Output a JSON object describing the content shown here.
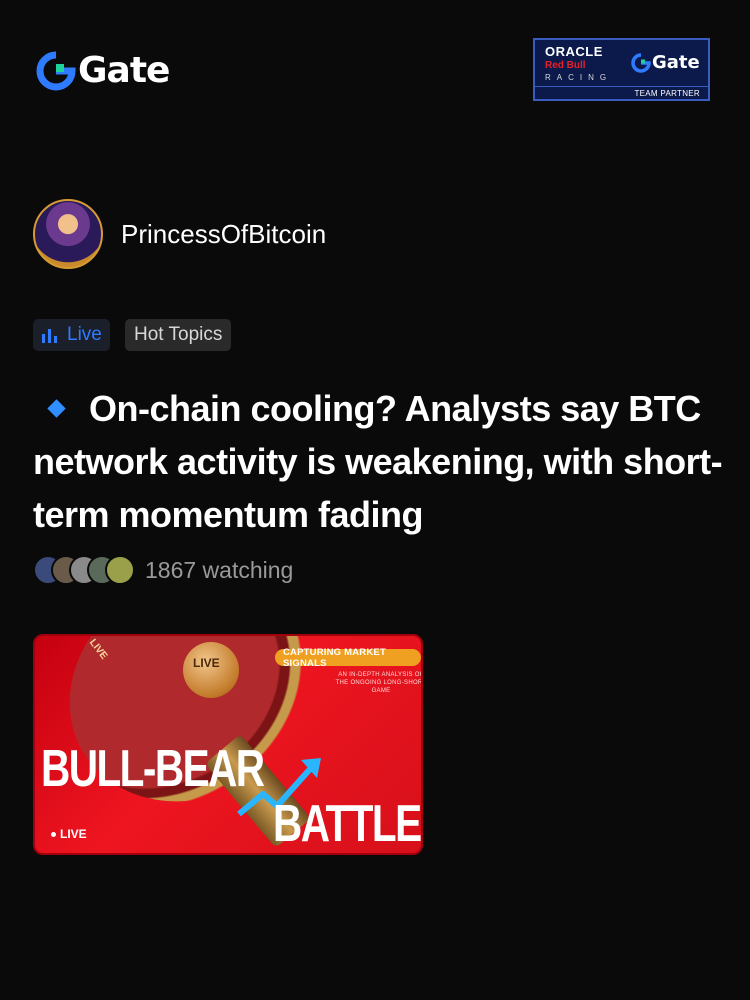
{
  "header": {
    "logo_text": "Gate",
    "partner": {
      "oracle": "ORACLE",
      "redbull": "Red Bull",
      "racing": "RACING",
      "gate": "Gate",
      "team_partner": "TEAM PARTNER"
    }
  },
  "user": {
    "name": "PrincessOfBitcoin"
  },
  "tags": [
    {
      "label": "Live",
      "icon": "bar-chart-icon",
      "color": "#2f7bff"
    },
    {
      "label": "Hot Topics"
    }
  ],
  "post": {
    "title": "On-chain cooling? Analysts say BTC network activity is weakening, with short-term momentum fading",
    "bullet_color": "#2f8fff"
  },
  "watching": {
    "count_text": "1867 watching",
    "avatars": [
      "#3a4a7a",
      "#6a5a4a",
      "#8a8a8a",
      "#5a6a5a",
      "#9aa04a"
    ]
  },
  "thumbnail": {
    "ball_text": "LIVE",
    "curve_text": "LIVE",
    "capsule": "CAPTURING MARKET SIGNALS",
    "subtitle": "AN IN-DEPTH ANALYSIS OF THE ONGOING LONG-SHORT GAME",
    "headline_1": "BULL-BEAR",
    "headline_2": "BATTLE",
    "live_badge": "LIVE"
  },
  "colors": {
    "background": "#0a0a0a",
    "accent": "#2f7bff",
    "thumb_red": "#ee1520"
  }
}
